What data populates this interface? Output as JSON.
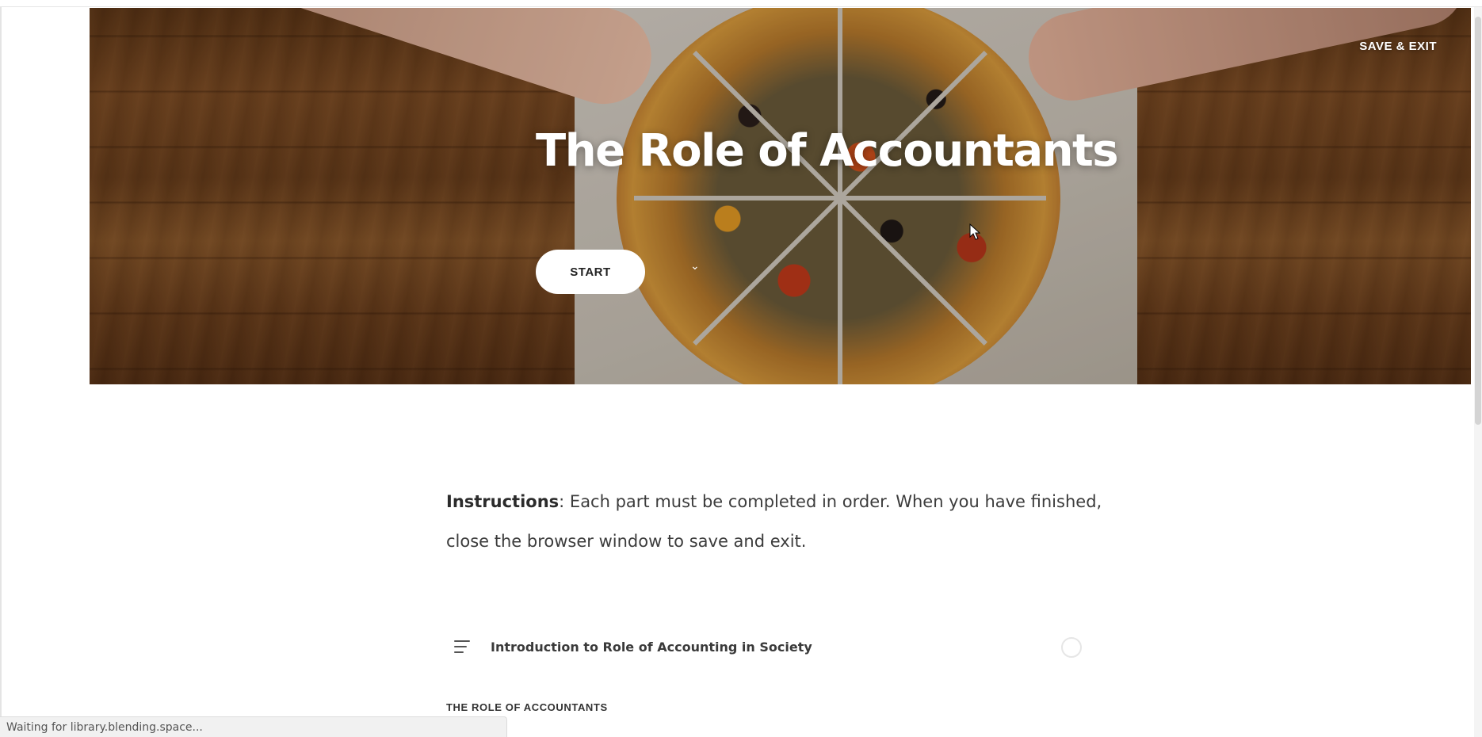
{
  "header": {
    "save_exit_label": "SAVE & EXIT"
  },
  "hero": {
    "title": "The Role of Accountants",
    "start_label": "START",
    "scroll_icon": "chevron-down-icon"
  },
  "instructions": {
    "label": "Instructions",
    "text": ": Each part must be completed in order. When you have finished, close the browser window to save and exit."
  },
  "lessons": [
    {
      "title": "Introduction to Role of Accounting in Society",
      "icon": "text-lines-icon",
      "status": "incomplete"
    }
  ],
  "section": {
    "heading": "THE ROLE OF ACCOUNTANTS"
  },
  "status_bar": {
    "text": "Waiting for library.blending.space..."
  }
}
